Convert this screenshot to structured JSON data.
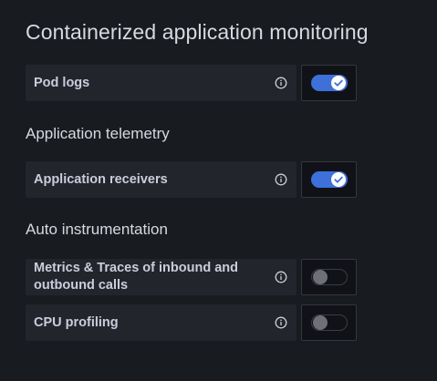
{
  "page": {
    "title": "Containerized application monitoring"
  },
  "settings": {
    "pod_logs": {
      "label": "Pod logs",
      "enabled": true
    },
    "application_telemetry_heading": "Application telemetry",
    "application_receivers": {
      "label": "Application receivers",
      "enabled": true
    },
    "auto_instrumentation_heading": "Auto instrumentation",
    "metrics_traces": {
      "label": "Metrics & Traces of inbound and outbound calls",
      "enabled": false
    },
    "cpu_profiling": {
      "label": "CPU profiling",
      "enabled": false
    }
  },
  "icons": {
    "info": "info-circle-icon",
    "check": "checkmark-icon"
  },
  "colors": {
    "background": "#181b1f",
    "row_background": "#22252b",
    "toggle_on": "#3d71d9",
    "toggle_off_knob": "#6e7078",
    "text": "#ccccdc"
  }
}
